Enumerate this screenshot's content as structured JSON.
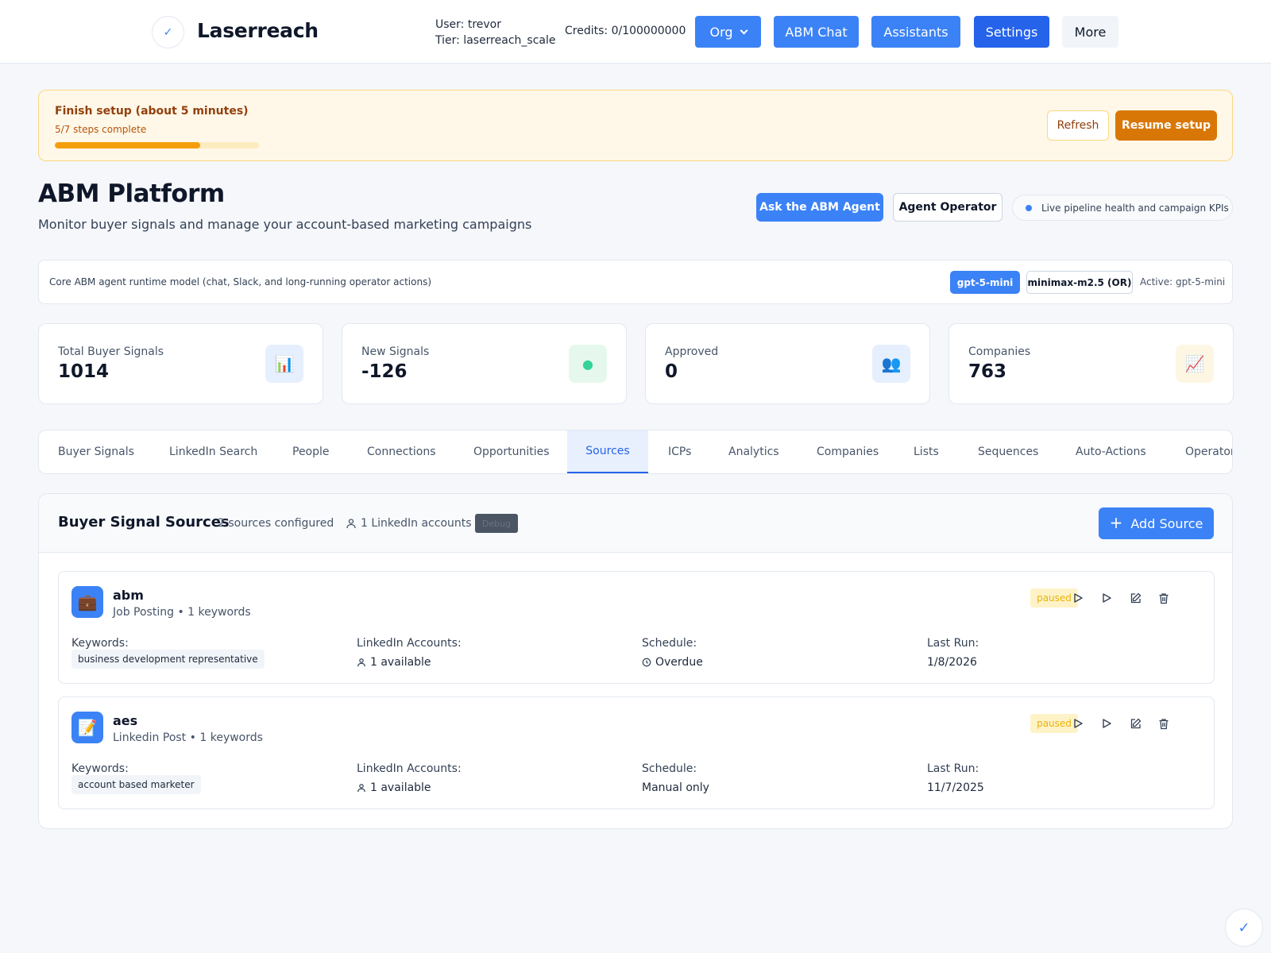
{
  "header": {
    "brand": "Laserreach",
    "user": "User: trevor",
    "tier": "Tier: laserreach_scale",
    "credits": "Credits: 0/100000000",
    "buttons": {
      "org": "Org",
      "abm_chat": "ABM Chat",
      "assistants": "Assistants",
      "settings": "Settings",
      "more": "More"
    }
  },
  "setup": {
    "title": "Finish setup (about 5 minutes)",
    "progress_text": "5/7 steps complete",
    "progress_fraction": 0.714,
    "refresh": "Refresh",
    "resume": "Resume setup"
  },
  "page": {
    "title": "ABM Platform",
    "subtitle": "Monitor buyer signals and manage your account-based marketing campaigns",
    "ask_agent": "Ask the ABM Agent",
    "agent_operator": "Agent Operator",
    "live_pill": "Live pipeline health and campaign KPIs"
  },
  "model": {
    "label": "Core ABM agent runtime model (chat, Slack, and long-running operator actions)",
    "options": [
      "gpt-5-mini",
      "minimax-m2.5 (OR)"
    ],
    "active": "Active: gpt-5-mini"
  },
  "stats": [
    {
      "label": "Total Buyer Signals",
      "value": "1014",
      "icon": "📊",
      "icon_bg": "#e6effd"
    },
    {
      "label": "New Signals",
      "value": "-126",
      "icon": "●",
      "icon_bg": "#e6f8ee"
    },
    {
      "label": "Approved",
      "value": "0",
      "icon": "👥",
      "icon_bg": "#e6effd"
    },
    {
      "label": "Companies",
      "value": "763",
      "icon": "📈",
      "icon_bg": "#fdf6e3"
    }
  ],
  "tabs": [
    "Buyer Signals",
    "LinkedIn Search",
    "People",
    "Connections",
    "Opportunities",
    "Sources",
    "ICPs",
    "Analytics",
    "Companies",
    "Lists",
    "Sequences",
    "Auto-Actions",
    "Operator"
  ],
  "active_tab": "Sources",
  "sources_panel": {
    "title": "Buyer Signal Sources",
    "count": "2 sources configured",
    "accounts": "1 LinkedIn accounts",
    "debug": "Debug",
    "add": "Add Source",
    "labels": {
      "keywords": "Keywords:",
      "accounts": "LinkedIn Accounts:",
      "schedule": "Schedule:",
      "last_run": "Last Run:"
    },
    "sources": [
      {
        "name": "abm",
        "type": "Job Posting",
        "kw_count": "1 keywords",
        "icon": "💼",
        "status": "paused",
        "keyword": "business development representative",
        "accounts": "1 available",
        "schedule": "Overdue",
        "last_run": "1/8/2026"
      },
      {
        "name": "aes",
        "type": "Linkedin Post",
        "kw_count": "1 keywords",
        "icon": "📝",
        "status": "paused",
        "keyword": "account based marketer",
        "accounts": "1 available",
        "schedule": "Manual only",
        "last_run": "11/7/2025"
      }
    ]
  },
  "colors": {
    "primary": "#3b82f6",
    "primary_dark": "#2563eb",
    "warning": "#d97706",
    "paused": "#eab308"
  }
}
